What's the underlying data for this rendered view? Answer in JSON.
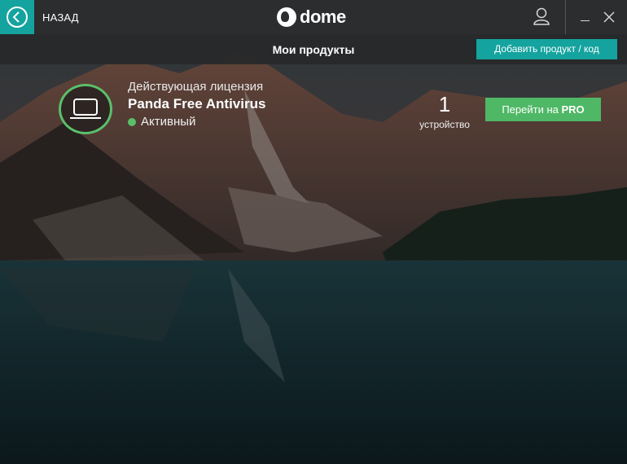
{
  "titlebar": {
    "back_label": "НАЗАД",
    "logo_text": "dome",
    "icons": {
      "back": "back-arrow-icon",
      "user": "user-icon",
      "minimize": "minimize-icon",
      "close": "close-icon"
    }
  },
  "header": {
    "title": "Мои продукты",
    "add_button_label": "Добавить продукт / код"
  },
  "product": {
    "license_label": "Действующая лицензия",
    "name": "Panda Free Antivirus",
    "status": "Активный",
    "device_count": "1",
    "device_label": "устройство",
    "upgrade_prefix": "Перейти на",
    "upgrade_emph": "PRO"
  },
  "colors": {
    "accent": "#14a39e",
    "green": "#4fb866",
    "status_green": "#5bbf6a",
    "titlebar": "#2b2d2f"
  }
}
